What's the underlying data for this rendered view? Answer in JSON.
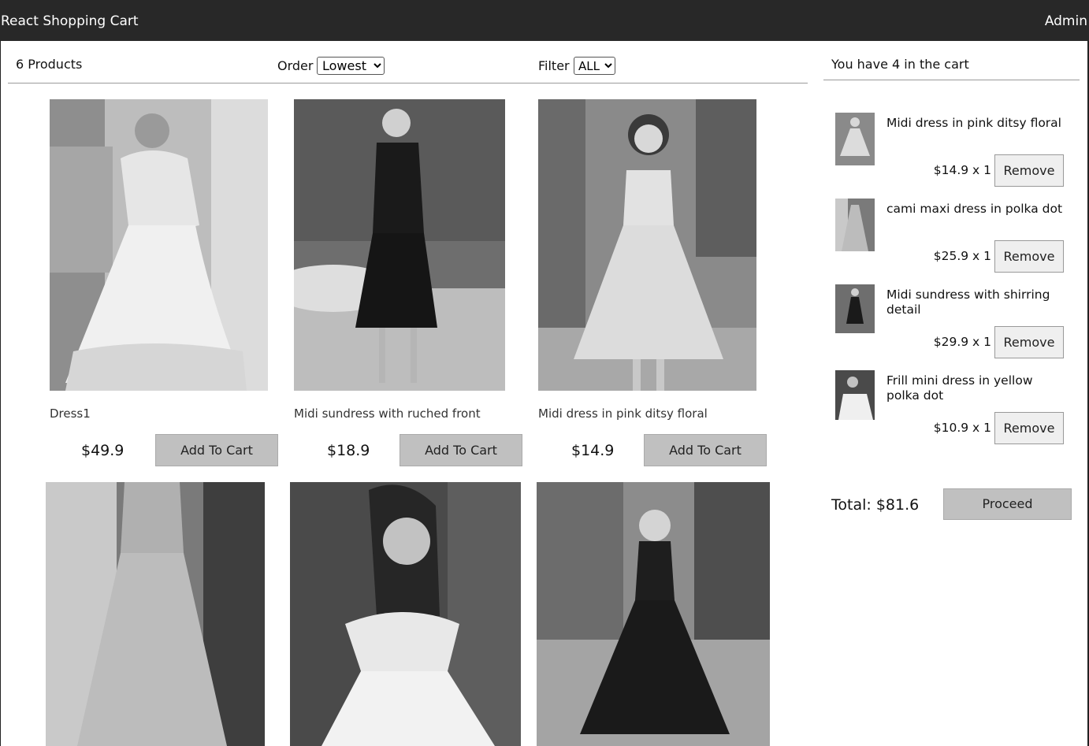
{
  "header": {
    "title": "React Shopping Cart",
    "admin": "Admin"
  },
  "filter": {
    "count": "6 Products",
    "order_label": "Order",
    "order_value": "Lowest",
    "filter_label": "Filter",
    "filter_value": "ALL"
  },
  "products": [
    {
      "name": "Dress1",
      "price": "$49.9",
      "button": "Add To Cart"
    },
    {
      "name": "Midi sundress with ruched front",
      "price": "$18.9",
      "button": "Add To Cart"
    },
    {
      "name": "Midi dress in pink ditsy floral",
      "price": "$14.9",
      "button": "Add To Cart"
    }
  ],
  "cart": {
    "title": "You have 4 in the cart",
    "items": [
      {
        "name": "Midi dress in pink ditsy floral",
        "qty": "$14.9 x 1",
        "button": "Remove"
      },
      {
        "name": "cami maxi dress in polka dot",
        "qty": "$25.9 x 1",
        "button": "Remove"
      },
      {
        "name": "Midi sundress with shirring detail",
        "qty": "$29.9 x 1",
        "button": "Remove"
      },
      {
        "name": "Frill mini dress in yellow polka dot",
        "qty": "$10.9 x 1",
        "button": "Remove"
      }
    ],
    "total": "Total: $81.6",
    "proceed": "Proceed"
  }
}
